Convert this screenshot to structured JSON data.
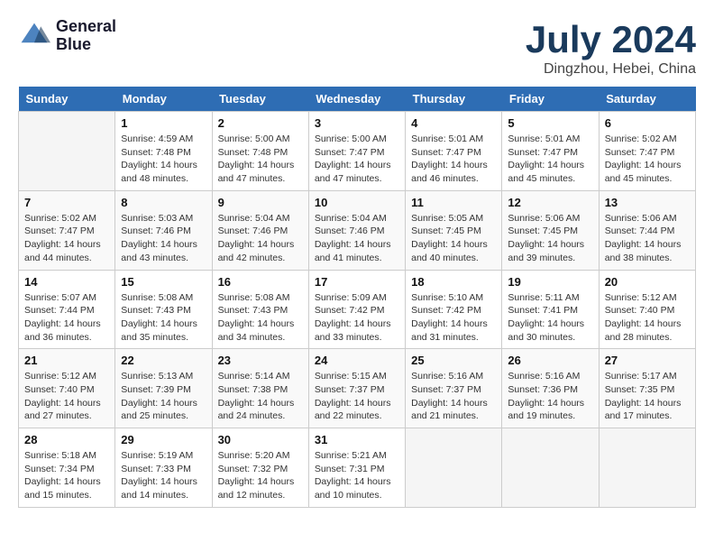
{
  "logo": {
    "line1": "General",
    "line2": "Blue"
  },
  "title": "July 2024",
  "location": "Dingzhou, Hebei, China",
  "days_of_week": [
    "Sunday",
    "Monday",
    "Tuesday",
    "Wednesday",
    "Thursday",
    "Friday",
    "Saturday"
  ],
  "weeks": [
    [
      {
        "day": "",
        "info": ""
      },
      {
        "day": "1",
        "info": "Sunrise: 4:59 AM\nSunset: 7:48 PM\nDaylight: 14 hours\nand 48 minutes."
      },
      {
        "day": "2",
        "info": "Sunrise: 5:00 AM\nSunset: 7:48 PM\nDaylight: 14 hours\nand 47 minutes."
      },
      {
        "day": "3",
        "info": "Sunrise: 5:00 AM\nSunset: 7:47 PM\nDaylight: 14 hours\nand 47 minutes."
      },
      {
        "day": "4",
        "info": "Sunrise: 5:01 AM\nSunset: 7:47 PM\nDaylight: 14 hours\nand 46 minutes."
      },
      {
        "day": "5",
        "info": "Sunrise: 5:01 AM\nSunset: 7:47 PM\nDaylight: 14 hours\nand 45 minutes."
      },
      {
        "day": "6",
        "info": "Sunrise: 5:02 AM\nSunset: 7:47 PM\nDaylight: 14 hours\nand 45 minutes."
      }
    ],
    [
      {
        "day": "7",
        "info": "Sunrise: 5:02 AM\nSunset: 7:47 PM\nDaylight: 14 hours\nand 44 minutes."
      },
      {
        "day": "8",
        "info": "Sunrise: 5:03 AM\nSunset: 7:46 PM\nDaylight: 14 hours\nand 43 minutes."
      },
      {
        "day": "9",
        "info": "Sunrise: 5:04 AM\nSunset: 7:46 PM\nDaylight: 14 hours\nand 42 minutes."
      },
      {
        "day": "10",
        "info": "Sunrise: 5:04 AM\nSunset: 7:46 PM\nDaylight: 14 hours\nand 41 minutes."
      },
      {
        "day": "11",
        "info": "Sunrise: 5:05 AM\nSunset: 7:45 PM\nDaylight: 14 hours\nand 40 minutes."
      },
      {
        "day": "12",
        "info": "Sunrise: 5:06 AM\nSunset: 7:45 PM\nDaylight: 14 hours\nand 39 minutes."
      },
      {
        "day": "13",
        "info": "Sunrise: 5:06 AM\nSunset: 7:44 PM\nDaylight: 14 hours\nand 38 minutes."
      }
    ],
    [
      {
        "day": "14",
        "info": "Sunrise: 5:07 AM\nSunset: 7:44 PM\nDaylight: 14 hours\nand 36 minutes."
      },
      {
        "day": "15",
        "info": "Sunrise: 5:08 AM\nSunset: 7:43 PM\nDaylight: 14 hours\nand 35 minutes."
      },
      {
        "day": "16",
        "info": "Sunrise: 5:08 AM\nSunset: 7:43 PM\nDaylight: 14 hours\nand 34 minutes."
      },
      {
        "day": "17",
        "info": "Sunrise: 5:09 AM\nSunset: 7:42 PM\nDaylight: 14 hours\nand 33 minutes."
      },
      {
        "day": "18",
        "info": "Sunrise: 5:10 AM\nSunset: 7:42 PM\nDaylight: 14 hours\nand 31 minutes."
      },
      {
        "day": "19",
        "info": "Sunrise: 5:11 AM\nSunset: 7:41 PM\nDaylight: 14 hours\nand 30 minutes."
      },
      {
        "day": "20",
        "info": "Sunrise: 5:12 AM\nSunset: 7:40 PM\nDaylight: 14 hours\nand 28 minutes."
      }
    ],
    [
      {
        "day": "21",
        "info": "Sunrise: 5:12 AM\nSunset: 7:40 PM\nDaylight: 14 hours\nand 27 minutes."
      },
      {
        "day": "22",
        "info": "Sunrise: 5:13 AM\nSunset: 7:39 PM\nDaylight: 14 hours\nand 25 minutes."
      },
      {
        "day": "23",
        "info": "Sunrise: 5:14 AM\nSunset: 7:38 PM\nDaylight: 14 hours\nand 24 minutes."
      },
      {
        "day": "24",
        "info": "Sunrise: 5:15 AM\nSunset: 7:37 PM\nDaylight: 14 hours\nand 22 minutes."
      },
      {
        "day": "25",
        "info": "Sunrise: 5:16 AM\nSunset: 7:37 PM\nDaylight: 14 hours\nand 21 minutes."
      },
      {
        "day": "26",
        "info": "Sunrise: 5:16 AM\nSunset: 7:36 PM\nDaylight: 14 hours\nand 19 minutes."
      },
      {
        "day": "27",
        "info": "Sunrise: 5:17 AM\nSunset: 7:35 PM\nDaylight: 14 hours\nand 17 minutes."
      }
    ],
    [
      {
        "day": "28",
        "info": "Sunrise: 5:18 AM\nSunset: 7:34 PM\nDaylight: 14 hours\nand 15 minutes."
      },
      {
        "day": "29",
        "info": "Sunrise: 5:19 AM\nSunset: 7:33 PM\nDaylight: 14 hours\nand 14 minutes."
      },
      {
        "day": "30",
        "info": "Sunrise: 5:20 AM\nSunset: 7:32 PM\nDaylight: 14 hours\nand 12 minutes."
      },
      {
        "day": "31",
        "info": "Sunrise: 5:21 AM\nSunset: 7:31 PM\nDaylight: 14 hours\nand 10 minutes."
      },
      {
        "day": "",
        "info": ""
      },
      {
        "day": "",
        "info": ""
      },
      {
        "day": "",
        "info": ""
      }
    ]
  ]
}
